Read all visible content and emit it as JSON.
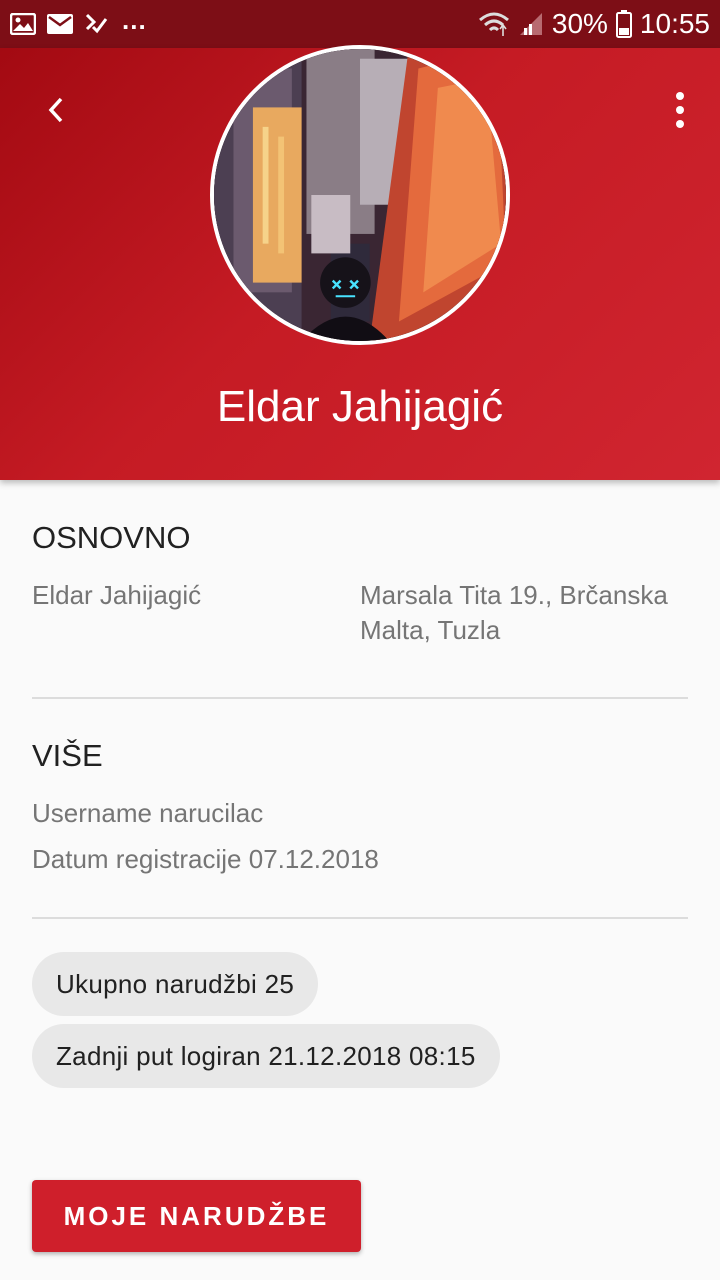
{
  "status_bar": {
    "dots": "...",
    "battery": "30%",
    "time": "10:55"
  },
  "header": {
    "name": "Eldar Jahijagić",
    "icons": [
      "back-arrow-icon",
      "more-vert-icon"
    ]
  },
  "basic": {
    "title": "OSNOVNO",
    "name": "Eldar Jahijagić",
    "address": "Marsala Tita 19., Brčanska Malta, Tuzla"
  },
  "more": {
    "title": "VIŠE",
    "username": "Username narucilac",
    "registration": "Datum registracije 07.12.2018"
  },
  "chips": {
    "total_orders": "Ukupno narudžbi 25",
    "last_login": "Zadnji put logiran 21.12.2018 08:15"
  },
  "button": {
    "label": "MOJE NARUDŽBE"
  },
  "colors": {
    "status_bar": "#7d0e16",
    "primary": "#c51b24",
    "button": "#cf1f2b",
    "chip": "#e8e8e8"
  }
}
